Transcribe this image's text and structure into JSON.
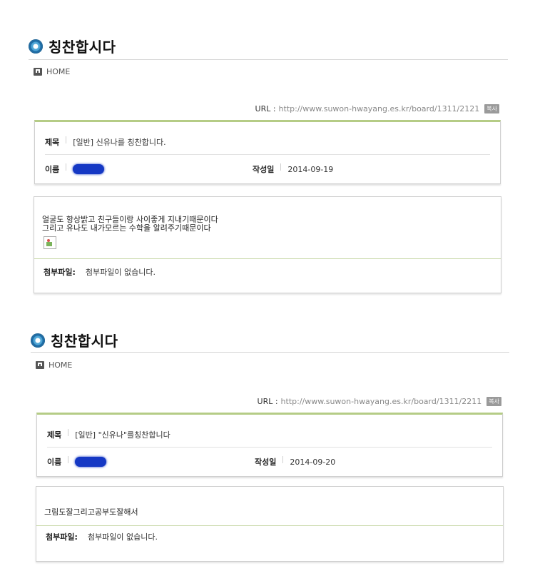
{
  "posts": [
    {
      "page_title": "칭찬합시다",
      "home_label": "HOME",
      "url_label": "URL :",
      "url": "http://www.suwon-hwayang.es.kr/board/1311/2121",
      "copy_label": "복사",
      "subject_label": "제목",
      "subject": "[일반] 신유나를 칭찬합니다.",
      "name_label": "이름",
      "date_label": "작성일",
      "date": "2014-09-19",
      "content_lines": [
        "얼굴도 항상밝고 친구들이랑 사이좋게 지내기때문이다",
        "그리고 유나도 내가모르는 수학을 알려주기때문이다"
      ],
      "attach_label": "첨부파일:",
      "attach_value": "첨부파일이 없습니다."
    },
    {
      "page_title": "칭찬합시다",
      "home_label": "HOME",
      "url_label": "URL :",
      "url": "http://www.suwon-hwayang.es.kr/board/1311/2211",
      "copy_label": "복사",
      "subject_label": "제목",
      "subject": "[일반] \"신유나\"를칭찬합니다",
      "name_label": "이름",
      "date_label": "작성일",
      "date": "2014-09-20",
      "content_lines": [
        "그림도잘그리고공부도잘해서"
      ],
      "attach_label": "첨부파일:",
      "attach_value": "첨부파일이 없습니다."
    }
  ],
  "colors": {
    "accent_border": "#b5cc86",
    "redaction": "#1538c4"
  },
  "icons": [
    "title-bullet-icon",
    "home-icon",
    "broken-image-icon"
  ]
}
